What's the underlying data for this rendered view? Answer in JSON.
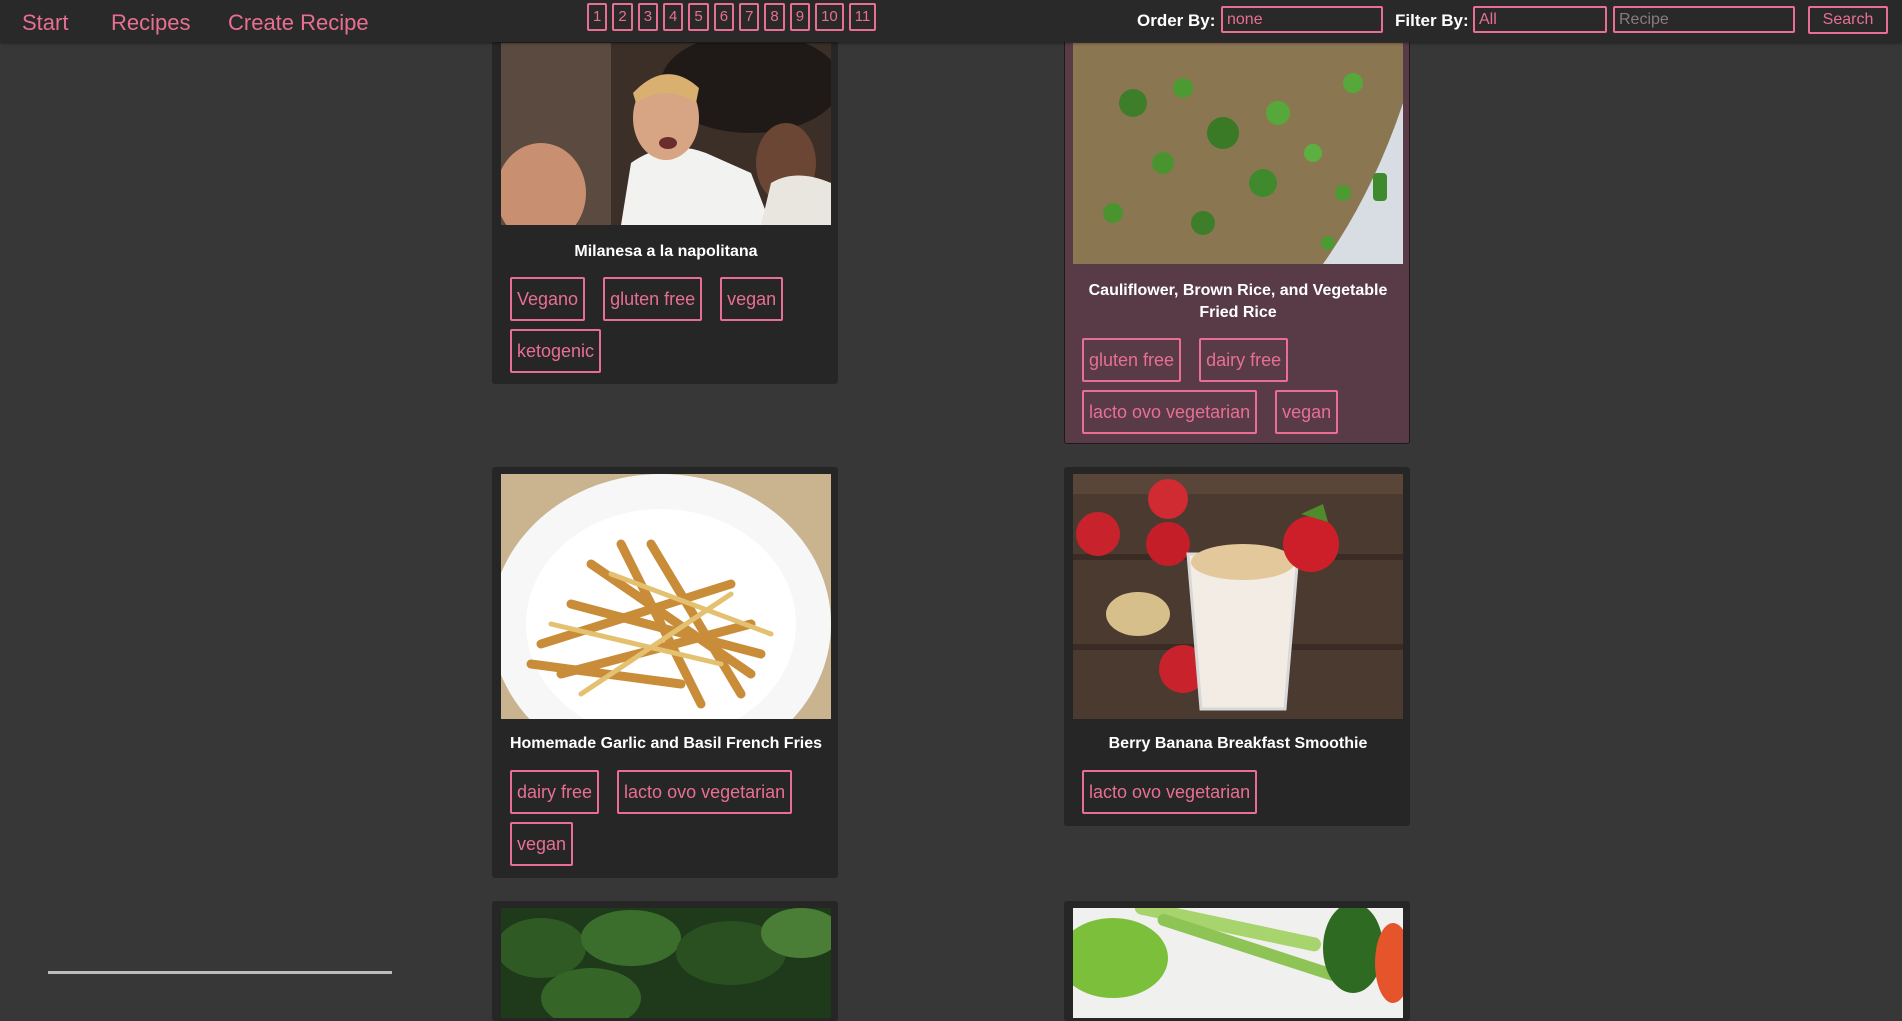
{
  "nav": {
    "links": [
      "Start",
      "Recipes",
      "Create Recipe"
    ],
    "pages": [
      "1",
      "2",
      "3",
      "4",
      "5",
      "6",
      "7",
      "8",
      "9",
      "10",
      "11"
    ],
    "order_label": "Order By:",
    "order_value": "none",
    "filter_label": "Filter By:",
    "filter_value": "All",
    "search_placeholder": "Recipe",
    "search_label": "Search"
  },
  "recipes": [
    {
      "title": "Milanesa a la napolitana",
      "tags": [
        "Vegano",
        "gluten free",
        "vegan",
        "ketogenic"
      ],
      "image": "chef-photo"
    },
    {
      "title": "Cauliflower, Brown Rice, and Vegetable Fried Rice",
      "tags": [
        "gluten free",
        "dairy free",
        "lacto ovo vegetarian",
        "vegan"
      ],
      "image": "fried-rice-photo"
    },
    {
      "title": "Homemade Garlic and Basil French Fries",
      "tags": [
        "dairy free",
        "lacto ovo vegetarian",
        "vegan"
      ],
      "image": "fries-photo"
    },
    {
      "title": "Berry Banana Breakfast Smoothie",
      "tags": [
        "lacto ovo vegetarian"
      ],
      "image": "smoothie-photo"
    },
    {
      "title": "",
      "tags": [],
      "image": "kale-photo"
    },
    {
      "title": "",
      "tags": [],
      "image": "vegetables-photo"
    }
  ],
  "colors": {
    "accent": "#e86f93",
    "page_bg": "#373737",
    "card_bg": "#262626",
    "card_active_bg": "#593b48"
  }
}
